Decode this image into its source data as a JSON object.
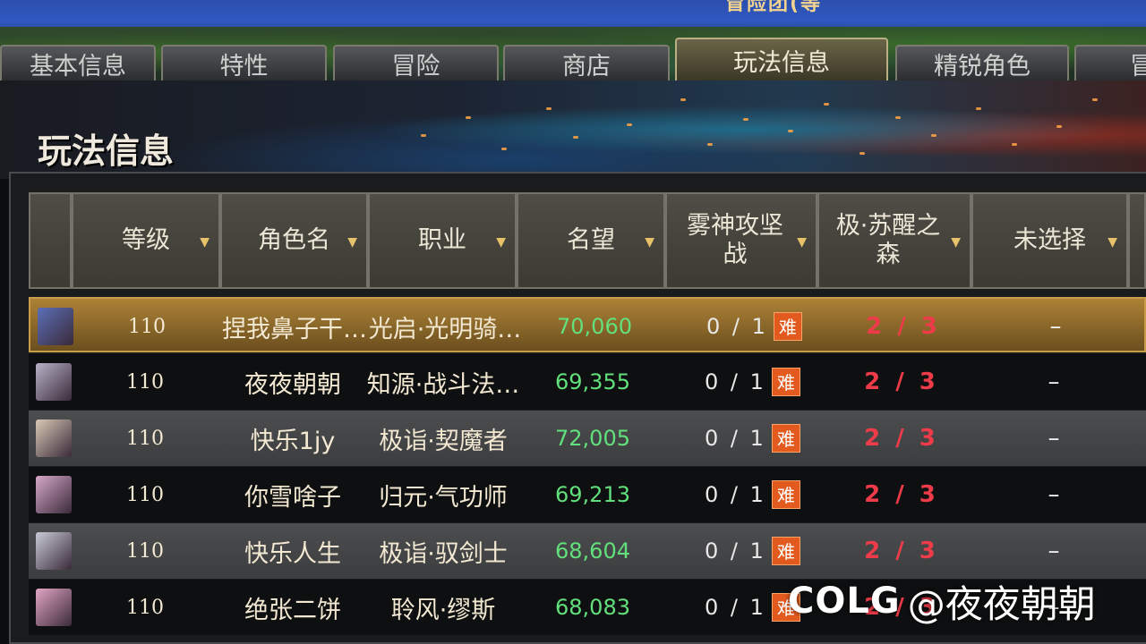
{
  "topbar": {
    "title_fragment": "冒险团(等"
  },
  "tabs": [
    {
      "label": "基本信息",
      "active": false
    },
    {
      "label": "特性",
      "active": false
    },
    {
      "label": "冒险",
      "active": false
    },
    {
      "label": "商店",
      "active": false
    },
    {
      "label": "玩法信息",
      "active": true
    },
    {
      "label": "精锐角色",
      "active": false
    },
    {
      "label": "冒",
      "active": false
    }
  ],
  "section_title": "玩法信息",
  "table": {
    "headers": {
      "level": "等级",
      "name": "角色名",
      "job": "职业",
      "fame": "名望",
      "fog": "雾神攻坚战",
      "forest": "极·苏醒之森",
      "unselected": "未选择"
    },
    "rows": [
      {
        "level": "110",
        "name": "捏我鼻子干…",
        "job": "光启·光明骑…",
        "fame": "70,060",
        "fog": "0 / 1",
        "fog_badge": "难",
        "forest": "2 / 3",
        "unselected": "–",
        "avatar_icon": "knight-avatar-icon",
        "avatar_color": "#5a6fb8"
      },
      {
        "level": "110",
        "name": "夜夜朝朝",
        "job": "知源·战斗法…",
        "fame": "69,355",
        "fog": "0 / 1",
        "fog_badge": "难",
        "forest": "2 / 3",
        "unselected": "–",
        "avatar_icon": "mage-avatar-icon",
        "avatar_color": "#b9b2c8"
      },
      {
        "level": "110",
        "name": "快乐1jy",
        "job": "极诣·契魔者",
        "fame": "72,005",
        "fog": "0 / 1",
        "fog_badge": "难",
        "forest": "2 / 3",
        "unselected": "–",
        "avatar_icon": "warlock-avatar-icon",
        "avatar_color": "#d8c9b4"
      },
      {
        "level": "110",
        "name": "你雪啥子",
        "job": "归元·气功师",
        "fame": "69,213",
        "fog": "0 / 1",
        "fog_badge": "难",
        "forest": "2 / 3",
        "unselected": "–",
        "avatar_icon": "nen-master-avatar-icon",
        "avatar_color": "#d6a8c9"
      },
      {
        "level": "110",
        "name": "快乐人生",
        "job": "极诣·驭剑士",
        "fame": "68,604",
        "fog": "0 / 1",
        "fog_badge": "难",
        "forest": "2 / 3",
        "unselected": "–",
        "avatar_icon": "swordsman-avatar-icon",
        "avatar_color": "#c9cbd8"
      },
      {
        "level": "110",
        "name": "绝张二饼",
        "job": "聆风·缪斯",
        "fame": "68,083",
        "fog": "0 / 1",
        "fog_badge": "难",
        "forest": "2 / 3",
        "unselected": "–",
        "avatar_icon": "muse-avatar-icon",
        "avatar_color": "#e2a6c4"
      }
    ]
  },
  "watermark": {
    "logo": "COLG",
    "text": "@夜夜朝朝"
  },
  "colors": {
    "fame": "#62e07c",
    "forest": "#ee3b4a",
    "badge": "#e25a1d",
    "selected_row": "#ad8237"
  }
}
